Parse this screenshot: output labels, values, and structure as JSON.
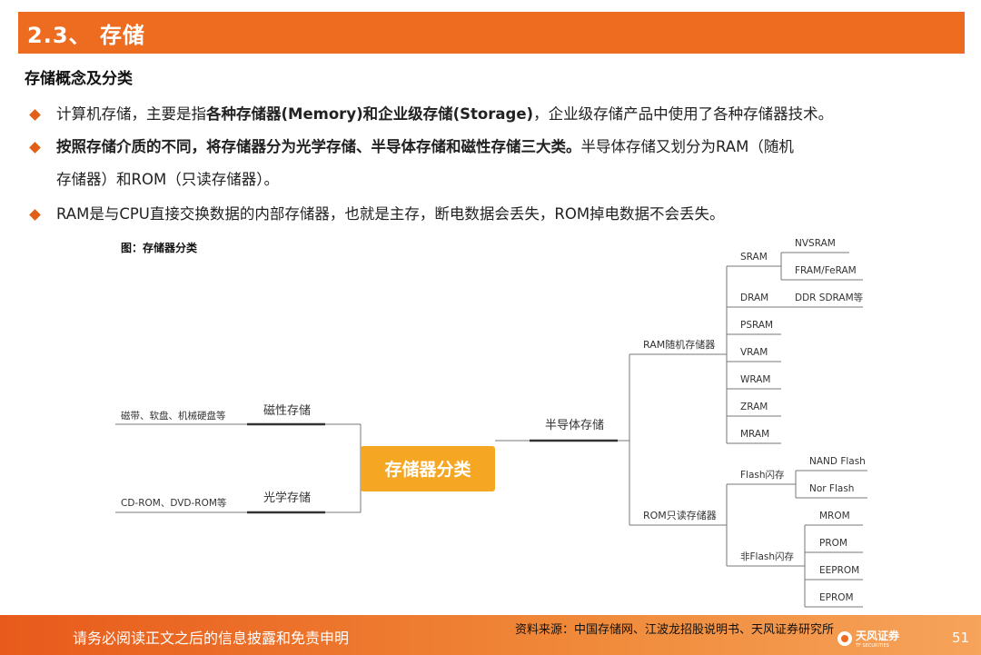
{
  "header": {
    "title": "2.3、 存储"
  },
  "section_title": "存储概念及分类",
  "bullets": [
    {
      "line1_pre": "计算机存储，主要是指",
      "line1_bold": "各种存储器(Memory)和企业级存储(Storage)",
      "line1_post": "，企业级存储产品中使用了各种存储器技术。"
    },
    {
      "line1_bold": "按照存储介质的不同，将存储器分为光学存储、半导体存储和磁性存储三大类。",
      "line1_post": "半导体存储又划分为RAM（随机",
      "line2": "存储器）和ROM（只读存储器）。"
    },
    {
      "line1": "RAM是与CPU直接交换数据的内部存储器，也就是主存，断电数据会丢失，ROM掉电数据不会丢失。"
    }
  ],
  "figure": {
    "caption": "图：存储器分类",
    "root": "存储器分类",
    "magnetic": {
      "label": "磁性存储",
      "example": "磁带、软盘、机械硬盘等"
    },
    "optical": {
      "label": "光学存储",
      "example": "CD-ROM、DVD-ROM等"
    },
    "semiconductor": "半导体存储",
    "ram": {
      "label": "RAM随机存储器",
      "sram": "SRAM",
      "sram_children": [
        "NVSRAM",
        "FRAM/FeRAM"
      ],
      "dram": "DRAM",
      "dram_child": "DDR SDRAM等",
      "others": [
        "PSRAM",
        "VRAM",
        "WRAM",
        "ZRAM",
        "MRAM"
      ]
    },
    "rom": {
      "label": "ROM只读存储器",
      "flash": "Flash闪存",
      "flash_children": [
        "NAND Flash",
        "Nor Flash"
      ],
      "nonflash": "非Flash闪存",
      "nonflash_children": [
        "MROM",
        "PROM",
        "EEPROM",
        "EPROM"
      ]
    }
  },
  "source": "资料来源：中国存储网、江波龙招股说明书、天风证券研究所",
  "footer": {
    "disclaimer": "请务必阅读正文之后的信息披露和免责申明",
    "brand": "天风证券",
    "brand_sub": "TF SECURITIES",
    "page": "51"
  }
}
